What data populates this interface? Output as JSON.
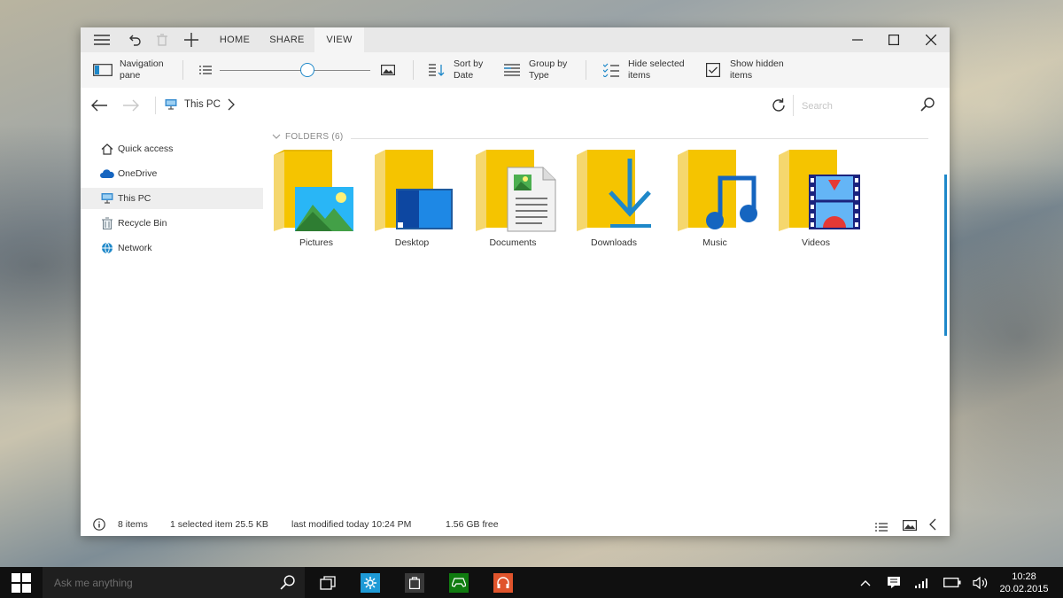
{
  "titlebar": {
    "tabs": [
      {
        "label": "HOME",
        "active": false
      },
      {
        "label": "SHARE",
        "active": false
      },
      {
        "label": "VIEW",
        "active": true
      }
    ],
    "icons": [
      "menu-icon",
      "undo-icon",
      "delete-icon",
      "new-icon"
    ],
    "window_controls": [
      "minimize-icon",
      "maximize-icon",
      "close-icon"
    ]
  },
  "ribbon": {
    "navigation_pane": "Navigation\npane",
    "zoom_slider_value": 0.58,
    "sort_by": "Sort by\nDate",
    "group_by": "Group by\nType",
    "hide_selected": "Hide selected\nitems",
    "show_hidden": "Show hidden\nitems"
  },
  "address": {
    "location": "This PC",
    "search_placeholder": "Search"
  },
  "sidebar": {
    "items": [
      {
        "label": "Quick access",
        "icon": "home-icon"
      },
      {
        "label": "OneDrive",
        "icon": "cloud-icon"
      },
      {
        "label": "This PC",
        "icon": "pc-icon",
        "selected": true
      },
      {
        "label": "Recycle Bin",
        "icon": "recycle-bin-icon"
      },
      {
        "label": "Network",
        "icon": "network-icon"
      }
    ]
  },
  "content": {
    "group_header": "FOLDERS (6)",
    "folders": [
      {
        "name": "Pictures",
        "icon": "pictures-folder-icon"
      },
      {
        "name": "Desktop",
        "icon": "desktop-folder-icon"
      },
      {
        "name": "Documents",
        "icon": "documents-folder-icon"
      },
      {
        "name": "Downloads",
        "icon": "downloads-folder-icon"
      },
      {
        "name": "Music",
        "icon": "music-folder-icon"
      },
      {
        "name": "Videos",
        "icon": "videos-folder-icon"
      }
    ]
  },
  "status": {
    "items": "8 items",
    "selected": "1 selected item 25.5 KB",
    "modified": "last modified today 10:24 PM",
    "free": "1.56 GB free"
  },
  "taskbar": {
    "search_placeholder": "Ask me anything",
    "time": "10:28",
    "date": "20.02.2015",
    "colors": {
      "settings": "#1e9ad6",
      "store": "#3a3a3a",
      "xbox": "#107c10",
      "music": "#e0542c"
    }
  }
}
